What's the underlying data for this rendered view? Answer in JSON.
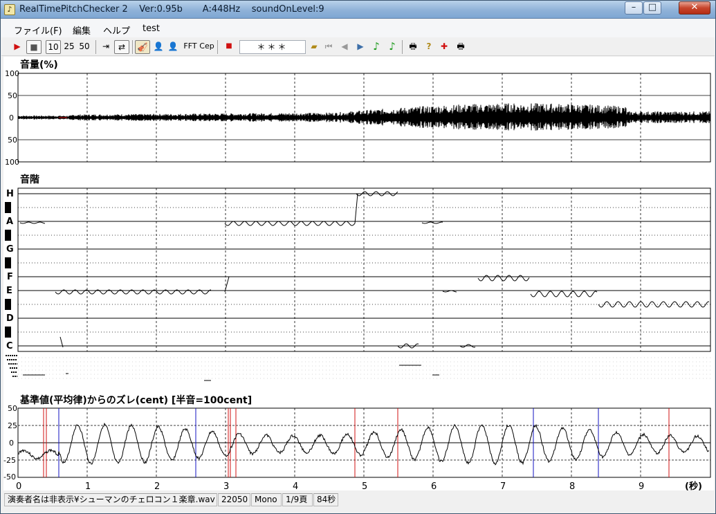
{
  "window": {
    "title": "RealTimePitchChecker 2    Ver:0.95b       A:448Hz    soundOnLevel:9",
    "close_label": "✕"
  },
  "menu": {
    "items": [
      "ファイル(F)",
      "編集",
      "ヘルプ",
      "test"
    ]
  },
  "toolbar": {
    "play_icon": "▶",
    "stop_icon": "■",
    "scale_10": "10",
    "scale_25": "25",
    "scale_50": "50",
    "jump_icon": "⇥",
    "loop_icon": "⇄",
    "fft_label": "FFT",
    "cep_label": "Cep",
    "record_icon": "■",
    "status_value": "＊＊＊",
    "open_icon": "📂",
    "note1_icon": "♪",
    "note2_icon": "♪",
    "help_icon": "?"
  },
  "volume_panel": {
    "title": "音量(%)",
    "y_labels": [
      "100",
      "50",
      "0",
      "50",
      "100"
    ]
  },
  "scale_panel": {
    "title": "音階",
    "notes": [
      "H",
      "A",
      "G",
      "F",
      "E",
      "D",
      "C"
    ]
  },
  "deviation_panel": {
    "title": "基準値(平均律)からのズレ(cent) [半音=100cent]",
    "y_labels": [
      "50",
      "25",
      "0",
      "-25",
      "-50"
    ],
    "x_labels": [
      "0",
      "1",
      "2",
      "3",
      "4",
      "5",
      "6",
      "7",
      "8",
      "9"
    ],
    "x_unit": "(秒)"
  },
  "statusbar": {
    "file": "演奏者名は非表示¥シューマンのチェロコン１楽章.wav",
    "rate": "22050",
    "channels": "Mono",
    "page": "1/9頁",
    "duration": "84秒"
  },
  "colors": {
    "accent_red": "#d01010",
    "accent_blue": "#1010c0",
    "plot_line": "#000000"
  }
}
